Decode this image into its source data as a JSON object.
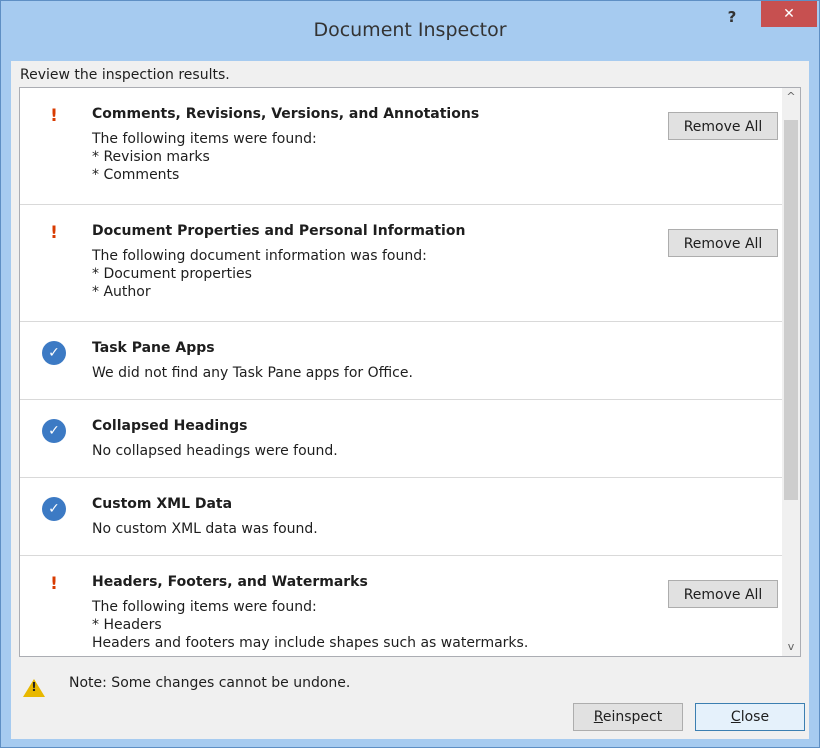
{
  "window": {
    "title": "Document Inspector",
    "help_label": "?",
    "close_label": "✕"
  },
  "subtitle": "Review the inspection results.",
  "results": [
    {
      "status": "warning",
      "title": "Comments, Revisions, Versions, and Annotations",
      "lines": [
        "The following items were found:",
        "* Revision marks",
        "* Comments"
      ],
      "action": "Remove All"
    },
    {
      "status": "warning",
      "title": "Document Properties and Personal Information",
      "lines": [
        "The following document information was found:",
        "* Document properties",
        "* Author"
      ],
      "action": "Remove All"
    },
    {
      "status": "ok",
      "title": "Task Pane Apps",
      "lines": [
        "We did not find any Task Pane apps for Office."
      ]
    },
    {
      "status": "ok",
      "title": "Collapsed Headings",
      "lines": [
        "No collapsed headings were found."
      ]
    },
    {
      "status": "ok",
      "title": "Custom XML Data",
      "lines": [
        "No custom XML data was found."
      ]
    },
    {
      "status": "warning",
      "title": "Headers, Footers, and Watermarks",
      "lines": [
        "The following items were found:",
        "* Headers",
        "Headers and footers may include shapes such as watermarks."
      ],
      "action": "Remove All"
    }
  ],
  "icons": {
    "warning": "!",
    "ok": "✓",
    "scroll_up": "^",
    "scroll_down": "v"
  },
  "note": "Note: Some changes cannot be undone.",
  "buttons": {
    "reinspect_mnemonic": "R",
    "reinspect_rest": "einspect",
    "close_mnemonic": "C",
    "close_rest": "lose"
  },
  "colors": {
    "title_bar": "#a6cbf0",
    "close_button": "#c75050",
    "warning": "#d83b01",
    "ok": "#3c7ac4"
  }
}
